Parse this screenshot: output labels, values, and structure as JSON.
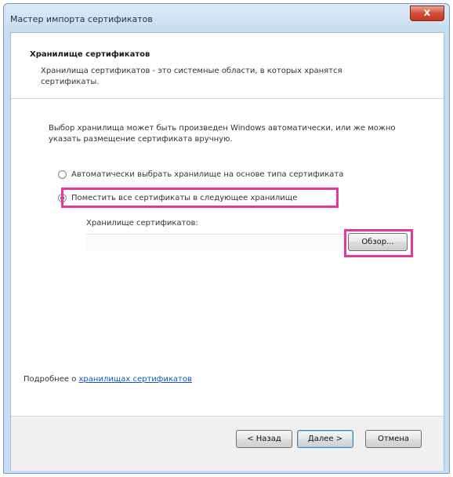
{
  "window": {
    "title": "Мастер импорта сертификатов",
    "close_glyph": "x"
  },
  "header": {
    "title": "Хранилище сертификатов",
    "description": "Хранилища сертификатов - это системные области, в которых хранятся сертификаты."
  },
  "body": {
    "intro": "Выбор хранилища может быть произведен Windows автоматически, или же можно указать размещение сертификата вручную.",
    "option_auto": {
      "label": "Автоматически выбрать хранилище на основе типа сертификата",
      "selected": false
    },
    "option_manual": {
      "label": "Поместить все сертификаты в следующее хранилище",
      "selected": true
    },
    "store_label": "Хранилище сертификатов:",
    "store_value": "",
    "browse_label": "Обзор..."
  },
  "learn_more": {
    "prefix": "Подробнее о ",
    "link": "хранилищах сертификатов"
  },
  "footer": {
    "back_label": "< Назад",
    "next_label": "Далее >",
    "cancel_label": "Отмена"
  },
  "highlight_color": "#e6379a"
}
